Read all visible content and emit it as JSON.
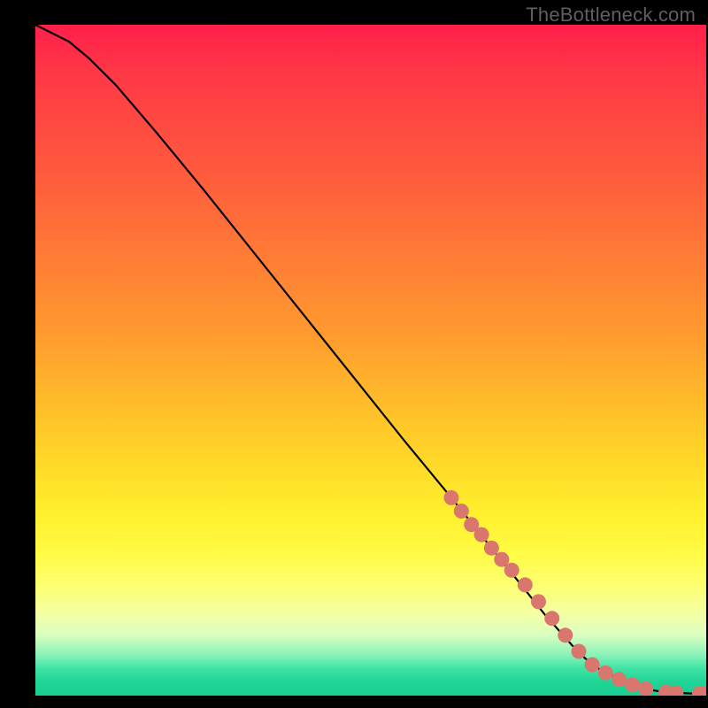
{
  "attribution": "TheBottleneck.com",
  "chart_data": {
    "type": "line",
    "title": "",
    "xlabel": "",
    "ylabel": "",
    "xlim": [
      0,
      100
    ],
    "ylim": [
      0,
      100
    ],
    "series": [
      {
        "name": "curve",
        "x": [
          0,
          2,
          5,
          8,
          12,
          18,
          25,
          35,
          45,
          55,
          62,
          68,
          72,
          76,
          80,
          82,
          84,
          86,
          88,
          90,
          92,
          94,
          96,
          98,
          100
        ],
        "y": [
          100,
          99,
          97.5,
          95,
          91,
          84,
          75.5,
          63,
          50.5,
          38,
          29.5,
          22,
          17,
          12,
          7.5,
          5.5,
          4,
          3,
          2,
          1.3,
          0.8,
          0.5,
          0.4,
          0.3,
          0.3
        ]
      }
    ],
    "markers": {
      "name": "highlighted-points",
      "color": "#d9776f",
      "x": [
        62,
        63.5,
        65,
        66.5,
        68,
        69.5,
        71,
        73,
        75,
        77,
        79,
        81,
        83,
        85,
        87,
        89,
        91,
        94,
        95.5,
        99,
        100
      ],
      "y": [
        29.5,
        27.5,
        25.5,
        24,
        22,
        20.3,
        18.7,
        16.5,
        14,
        11.5,
        9,
        6.6,
        4.6,
        3.4,
        2.4,
        1.6,
        1.0,
        0.5,
        0.4,
        0.3,
        0.3
      ]
    }
  }
}
